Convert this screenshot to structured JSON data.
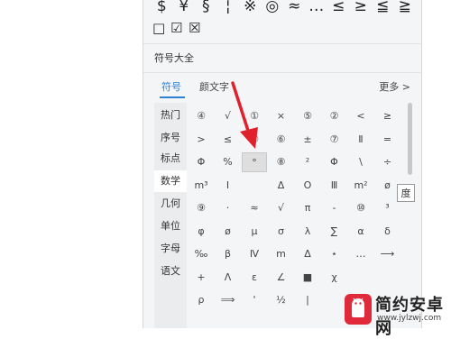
{
  "top_symbols": [
    "$",
    "¥",
    "§",
    "¦",
    "※",
    "◎",
    "≈",
    "…",
    "≤",
    "≥",
    "≦",
    "≧"
  ],
  "checkboxes": [
    "□",
    "☑",
    "☒"
  ],
  "section_title": "符号大全",
  "tabs": [
    {
      "label": "符号",
      "active": true
    },
    {
      "label": "颜文字",
      "active": false
    }
  ],
  "more_label": "更多 >",
  "categories": [
    {
      "label": "热门",
      "active": false
    },
    {
      "label": "序号",
      "active": false
    },
    {
      "label": "标点",
      "active": false
    },
    {
      "label": "数学",
      "active": true
    },
    {
      "label": "几何",
      "active": false
    },
    {
      "label": "单位",
      "active": false
    },
    {
      "label": "字母",
      "active": false
    },
    {
      "label": "语文",
      "active": false
    }
  ],
  "symbol_grid": [
    [
      "④",
      "√",
      "①",
      "×",
      "⑤",
      "②",
      "<",
      "≥"
    ],
    [
      ">",
      "≤",
      "③",
      "⑥",
      "±",
      "⑦",
      "Ⅱ",
      "="
    ],
    [
      "Φ",
      "%",
      "°",
      "⑧",
      "²",
      "Φ",
      "\\",
      "÷"
    ],
    [
      "m³",
      "Ⅰ",
      "",
      "Δ",
      "O",
      "Ⅲ",
      "m²",
      "ø"
    ],
    [
      "⑨",
      "·",
      "≈",
      "√",
      "π",
      "-",
      "⑩",
      "³"
    ],
    [
      "φ",
      "ø",
      "μ",
      "σ",
      "λ",
      "∑",
      "α",
      "δ"
    ],
    [
      "‰",
      "β",
      "Ⅳ",
      "m",
      "Δ",
      "⋆",
      "…",
      "⟶"
    ],
    [
      "+",
      "Λ",
      "ε",
      "∠",
      "■",
      "χ",
      "",
      ""
    ],
    [
      "ρ",
      "⟹",
      "'",
      "½",
      "|",
      "",
      "",
      ""
    ]
  ],
  "hovered_symbol": "°",
  "tooltip_text": "度",
  "watermark": {
    "title": "简约安卓网",
    "url": "www.jylzwj.com",
    "accent": "#e0293a"
  },
  "annotation_arrow_color": "#e0202a"
}
